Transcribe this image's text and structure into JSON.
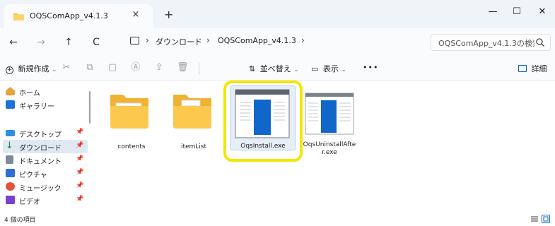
{
  "window": {
    "tab_title": "OQSComApp_v4.1.3",
    "close_tab": "×",
    "new_tab": "+",
    "minimize": "—",
    "maximize": "☐",
    "close": "✕"
  },
  "address": {
    "back": "←",
    "forward": "→",
    "up": "↑",
    "refresh": "C",
    "path": [
      "ダウンロード",
      "OQSComApp_v4.1.3"
    ],
    "search_placeholder": "OQSComApp_v4.1.3の検索"
  },
  "commands": {
    "new": "新規作成",
    "sort": "並べ替え",
    "view": "表示",
    "more": "•••",
    "details": "詳細"
  },
  "nav": {
    "items": [
      {
        "label": "ホーム",
        "icon": "home-icon",
        "pinned": false
      },
      {
        "label": "ギャラリー",
        "icon": "gallery-icon",
        "pinned": false
      },
      {
        "label": "デスクトップ",
        "icon": "desktop-icon",
        "pinned": true
      },
      {
        "label": "ダウンロード",
        "icon": "download-icon",
        "pinned": true
      },
      {
        "label": "ドキュメント",
        "icon": "documents-icon",
        "pinned": true
      },
      {
        "label": "ピクチャ",
        "icon": "pictures-icon",
        "pinned": true
      },
      {
        "label": "ミュージック",
        "icon": "music-icon",
        "pinned": true
      },
      {
        "label": "ビデオ",
        "icon": "videos-icon",
        "pinned": true
      }
    ],
    "selected": "ダウンロード"
  },
  "files": [
    {
      "name": "contents",
      "type": "folder"
    },
    {
      "name": "itemList",
      "type": "folder"
    },
    {
      "name": "OqsInstall.exe",
      "type": "exe",
      "highlighted": true
    },
    {
      "name_line1": "OqsUninstallAfte",
      "name_line2": "r.exe",
      "type": "exe"
    }
  ],
  "status": {
    "item_count": "4 個の項目"
  },
  "colors": {
    "highlight": "#f4e600",
    "folder": "#f8c24a",
    "accent": "#0a63c9"
  }
}
